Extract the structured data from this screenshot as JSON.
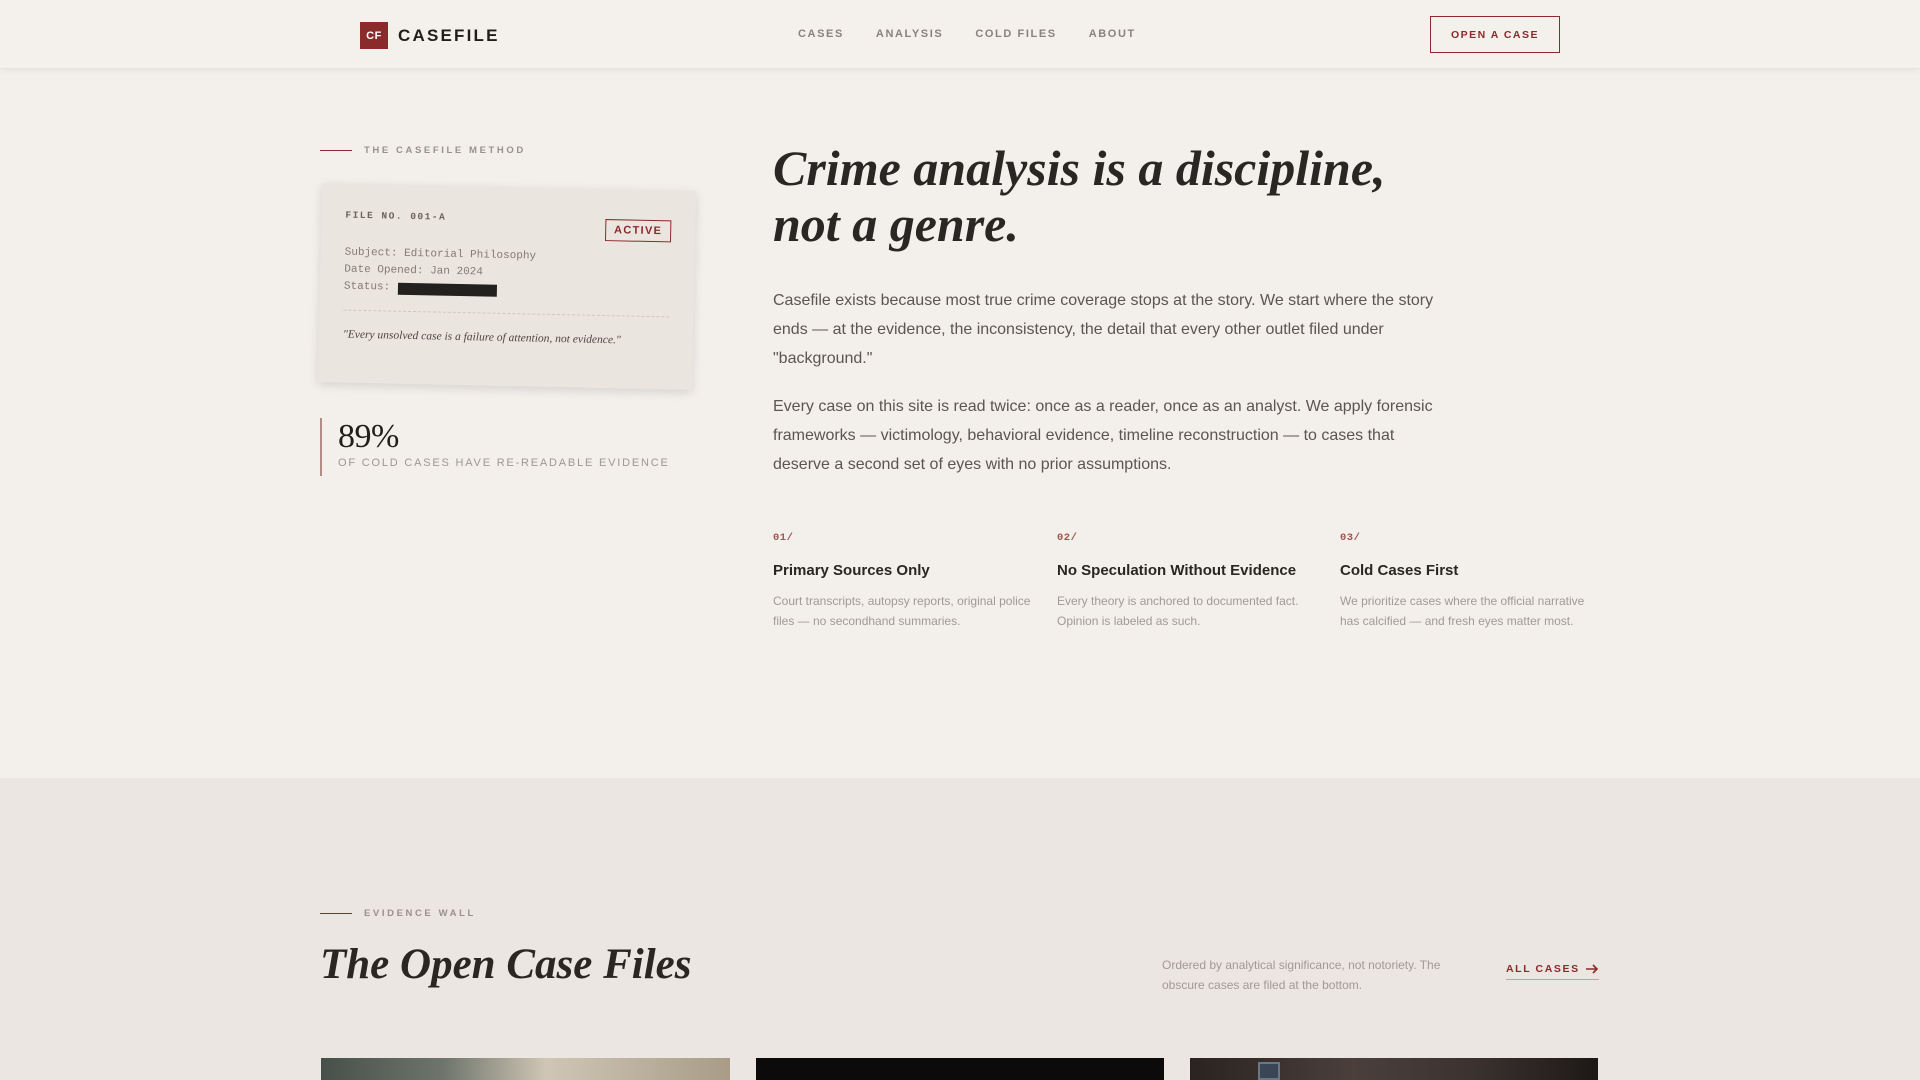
{
  "header": {
    "logo_mark": "CF",
    "logo_text": "CASEFILE",
    "nav": [
      "CASES",
      "ANALYSIS",
      "COLD FILES",
      "ABOUT"
    ],
    "cta": "OPEN A CASE"
  },
  "method": {
    "eyebrow": "THE CASEFILE METHOD",
    "card": {
      "file_no": "FILE NO. 001-A",
      "badge": "ACTIVE",
      "subject": "Subject: Editorial Philosophy",
      "date_opened": "Date Opened: Jan 2024",
      "status_label": "Status:",
      "quote": "\"Every unsolved case is a failure of attention, not evidence.\""
    },
    "stat": {
      "value": "89%",
      "label": "OF COLD CASES HAVE RE-READABLE EVIDENCE"
    },
    "headline_line1": "Crime analysis is a discipline,",
    "headline_line2": "not a genre.",
    "paragraph1": "Casefile exists because most true crime coverage stops at the story. We start where the story ends — at the evidence, the inconsistency, the detail that every other outlet filed under \"background.\"",
    "paragraph2": "Every case on this site is read twice: once as a reader, once as an analyst. We apply forensic frameworks — victimology, behavioral evidence, timeline reconstruction — to cases that deserve a second set of eyes with no prior assumptions.",
    "pillars": [
      {
        "num": "01/",
        "title": "Primary Sources Only",
        "desc": "Court transcripts, autopsy reports, original police files — no secondhand summaries."
      },
      {
        "num": "02/",
        "title": "No Speculation Without Evidence",
        "desc": "Every theory is anchored to documented fact. Opinion is labeled as such."
      },
      {
        "num": "03/",
        "title": "Cold Cases First",
        "desc": "We prioritize cases where the official narrative has calcified — and fresh eyes matter most."
      }
    ]
  },
  "evidence": {
    "eyebrow": "EVIDENCE WALL",
    "title": "The Open Case Files",
    "note": "Ordered by analytical significance, not notoriety. The obscure cases are filed at the bottom.",
    "all_cases": "ALL CASES"
  },
  "colors": {
    "accent": "#8b2a2a",
    "background": "#f3efeb",
    "section_bg": "#ebe6e1"
  },
  "icons": {
    "arrow": "arrow-right-icon"
  }
}
